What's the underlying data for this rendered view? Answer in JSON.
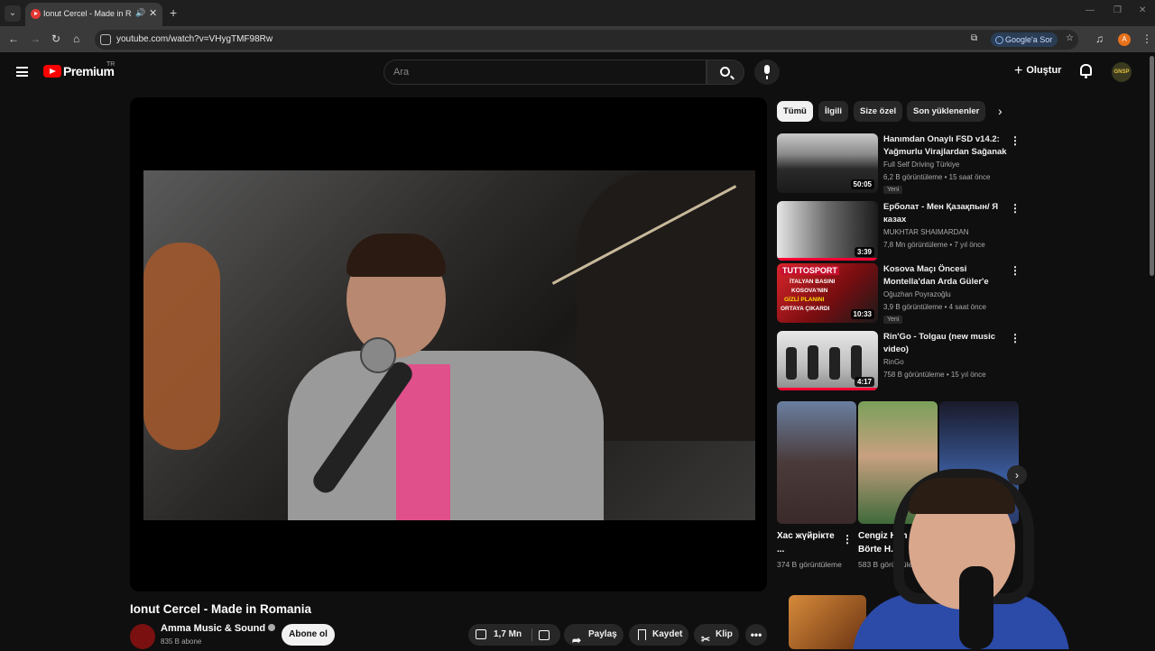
{
  "browser": {
    "tab_title": "Ionut Cercel - Made in Romania",
    "url": "youtube.com/watch?v=VHygTMF98Rw",
    "ask_google": "Google'a Sor",
    "profile_initial": "A"
  },
  "yt_header": {
    "logo_text": "Premium",
    "region": "TR",
    "search_placeholder": "Ara",
    "create_label": "Oluştur",
    "user_avatar_text": "GNSP"
  },
  "video": {
    "title": "Ionut Cercel - Made in Romania",
    "channel": "Amma Music & Sound",
    "subscribers": "835 B abone",
    "subscribe_label": "Abone ol",
    "likes": "1,7 Mn",
    "share_label": "Paylaş",
    "save_label": "Kaydet",
    "clip_label": "Klip"
  },
  "chips": [
    "Tümü",
    "İlgili",
    "Size özel",
    "Son yüklenenler"
  ],
  "recommendations": [
    {
      "title": "Hanımdan Onaylı FSD v14.2: Yağmurlu Virajlardan Sağanak ...",
      "channel": "Full Self Driving Türkiye",
      "meta": "6,2 B görüntüleme • 15 saat önce",
      "badge": "Yeni",
      "duration": "50:05"
    },
    {
      "title": "Ерболат - Мен Қазақпын/ Я казах",
      "channel": "MUKHTAR SHAIMARDAN",
      "meta": "7,8 Mn görüntüleme • 7 yıl önce",
      "badge": "",
      "duration": "3:39"
    },
    {
      "title": "Kosova Maçı Öncesi Montella'dan Arda Güler'e Özel...",
      "channel": "Oğuzhan Poyrazoğlu",
      "meta": "3,9 B görüntüleme • 4 saat önce",
      "badge": "Yeni",
      "duration": "10:33"
    },
    {
      "title": "Rin'Go - Tolgau (new music video)",
      "channel": "RinGo",
      "meta": "758 B görüntüleme • 15 yıl önce",
      "badge": "",
      "duration": "4:17"
    }
  ],
  "thumb_texts": {
    "tuttosport": "TUTTOSPORT",
    "kosova_line1": "İTALYAN BASINI",
    "kosova_line2": "KOSOVA'NIN",
    "kosova_line3": "GİZLİ PLANINI",
    "kosova_line4": "ORTAYA ÇIKARDI"
  },
  "shorts": [
    {
      "title": "Хас жүйрікте ...",
      "meta": "374 B görüntülеme"
    },
    {
      "title": "Cengiz Han ve Börte H...",
      "meta": "583 B görüntülеme"
    }
  ]
}
